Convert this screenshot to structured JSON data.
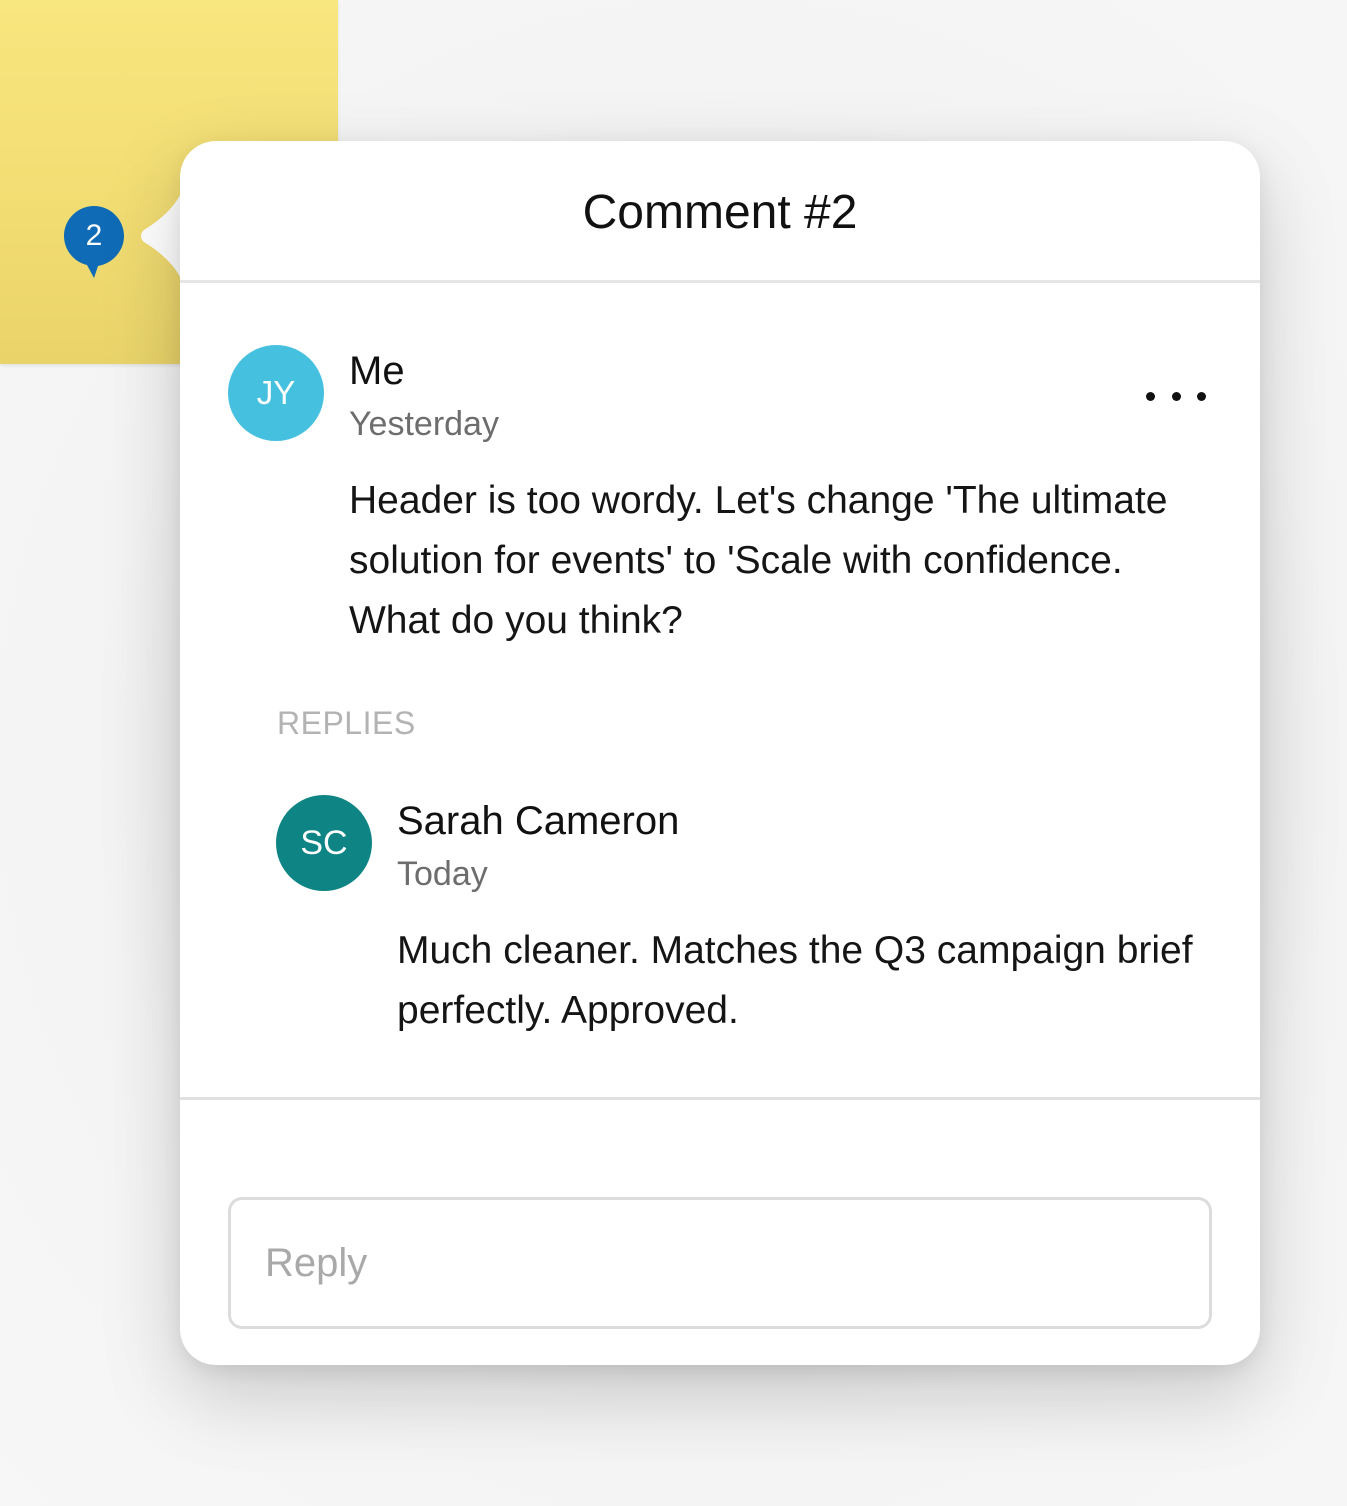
{
  "pin": {
    "number": "2",
    "color": "#0f6bb5"
  },
  "panel": {
    "title": "Comment #2"
  },
  "comment": {
    "avatar_initials": "JY",
    "avatar_color": "#45c1df",
    "author": "Me",
    "timestamp": "Yesterday",
    "body": "Header is too wordy. Let's change 'The ultimate solution for events' to 'Scale with confidence. What do you think?",
    "menu_icon": "more-horizontal-icon"
  },
  "replies": {
    "label": "REPLIES",
    "items": [
      {
        "avatar_initials": "SC",
        "avatar_color": "#0f8484",
        "author": "Sarah Cameron",
        "timestamp": "Today",
        "body": "Much cleaner. Matches the Q3 campaign brief perfectly. Approved."
      }
    ]
  },
  "reply_input": {
    "placeholder": "Reply",
    "value": ""
  },
  "colors": {
    "sticky_note": "#f4e072",
    "panel_background": "#ffffff"
  }
}
